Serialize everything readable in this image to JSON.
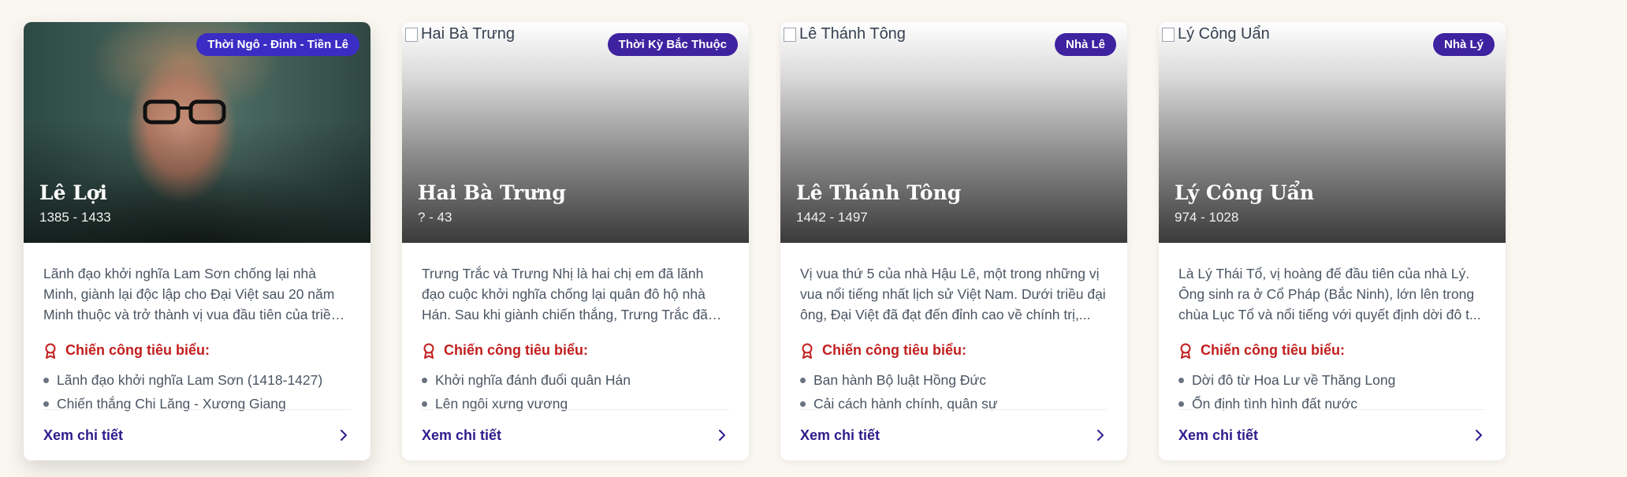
{
  "cards": [
    {
      "image_alt": "",
      "period": "Thời Ngô - Đinh - Tiền Lê",
      "name": "Lê Lợi",
      "years": "1385 - 1433",
      "description": "Lãnh đạo khởi nghĩa Lam Sơn chống lại nhà Minh, giành lại độc lập cho Đại Việt sau 20 năm Minh thuộc và trở thành vị vua đầu tiên của triều đại L...",
      "achievements_title": "Chiến công tiêu biểu:",
      "achievements": [
        "Lãnh đạo khởi nghĩa Lam Sơn (1418-1427)",
        "Chiến thắng Chi Lăng - Xương Giang"
      ],
      "more_label": "Xem chi tiết"
    },
    {
      "image_alt": "Hai Bà Trưng",
      "period": "Thời Kỳ Bắc Thuộc",
      "name": "Hai Bà Trưng",
      "years": "? - 43",
      "description": "Trưng Trắc và Trưng Nhị là hai chị em đã lãnh đạo cuộc khởi nghĩa chống lại quân đô hộ nhà Hán. Sau khi giành chiến thắng, Trưng Trắc đã lên ngô...",
      "achievements_title": "Chiến công tiêu biểu:",
      "achievements": [
        "Khởi nghĩa đánh đuổi quân Hán",
        "Lên ngôi xưng vương"
      ],
      "more_label": "Xem chi tiết"
    },
    {
      "image_alt": "Lê Thánh Tông",
      "period": "Nhà Lê",
      "name": "Lê Thánh Tông",
      "years": "1442 - 1497",
      "description": "Vị vua thứ 5 của nhà Hậu Lê, một trong những vị vua nổi tiếng nhất lịch sử Việt Nam. Dưới triều đại ông, Đại Việt đã đạt đến đỉnh cao về chính trị,...",
      "achievements_title": "Chiến công tiêu biểu:",
      "achievements": [
        "Ban hành Bộ luật Hồng Đức",
        "Cải cách hành chính, quân sự"
      ],
      "more_label": "Xem chi tiết"
    },
    {
      "image_alt": "Lý Công Uẩn",
      "period": "Nhà Lý",
      "name": "Lý Công Uẩn",
      "years": "974 - 1028",
      "description": "Là Lý Thái Tổ, vị hoàng đế đầu tiên của nhà Lý. Ông sinh ra ở Cổ Pháp (Bắc Ninh), lớn lên trong chùa Lục Tổ và nổi tiếng với quyết định dời đô t...",
      "achievements_title": "Chiến công tiêu biểu:",
      "achievements": [
        "Dời đô từ Hoa Lư về Thăng Long",
        "Ổn định tình hình đất nước"
      ],
      "more_label": "Xem chi tiết"
    }
  ],
  "icons": {
    "achievement": "award-icon",
    "more": "chevron-right-icon"
  },
  "colors": {
    "badge": "#3f22a0",
    "achievement_heading": "#c21e1e",
    "link": "#2e1d8c",
    "background": "#faf7f1"
  }
}
